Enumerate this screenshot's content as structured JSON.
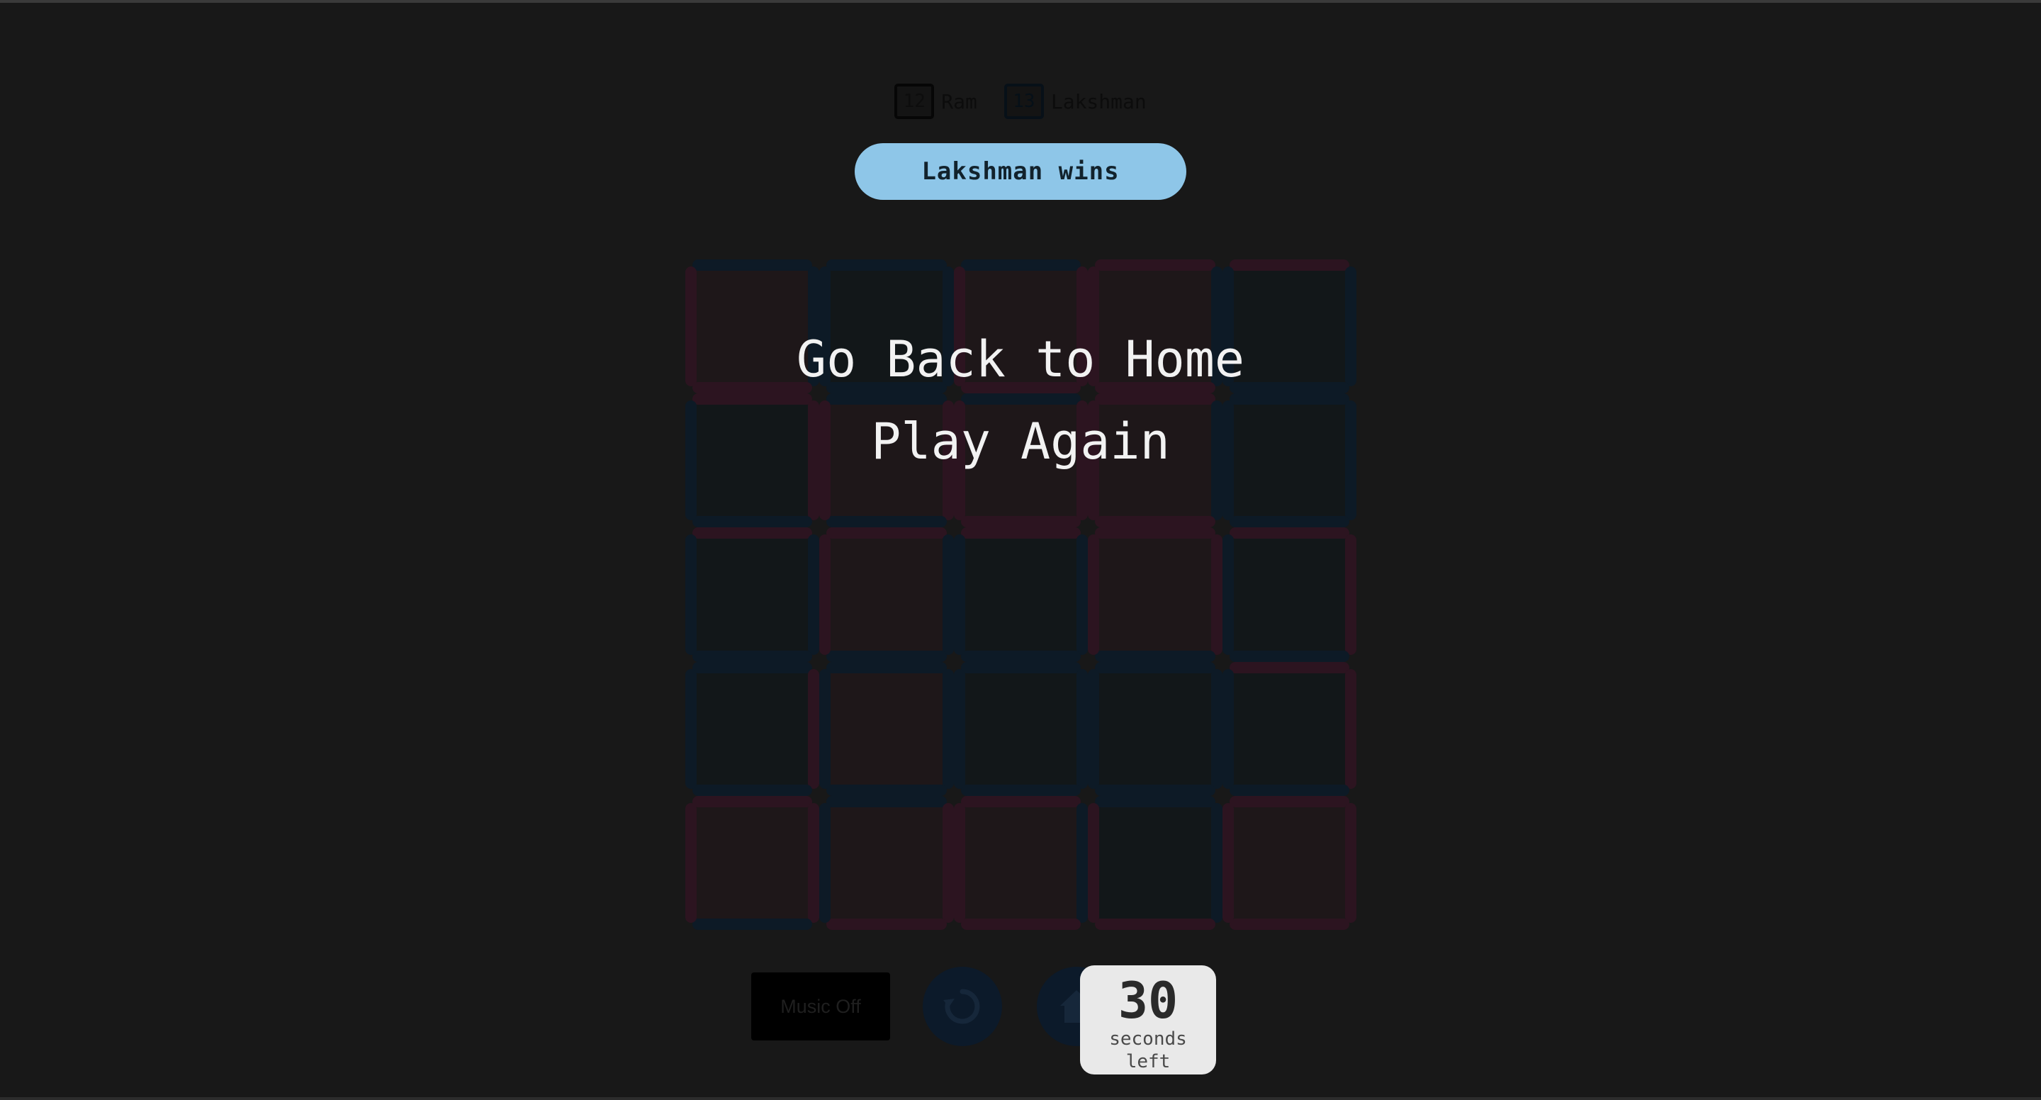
{
  "players": [
    {
      "name": "Ram",
      "score": "12"
    },
    {
      "name": "Lakshman",
      "score": "13"
    }
  ],
  "result": {
    "text": "Lakshman wins"
  },
  "menu": {
    "home_label": "Go Back to Home",
    "play_again_label": "Play Again"
  },
  "controls": {
    "music_label": "Music Off",
    "restart_icon": "restart-icon",
    "home_icon": "home-icon"
  },
  "timer": {
    "value": "30",
    "label": "seconds left"
  },
  "colors": {
    "background": "#181818",
    "banner": "#8ec6e8",
    "player1_edge": "#2c1420",
    "player2_edge": "#0d1a26",
    "player1_fill": "#1e1719",
    "player2_fill": "#121719",
    "timer_bg": "#e9e9e9"
  },
  "board": {
    "rows": 5,
    "cols": 5,
    "cell_owners": [
      [
        "p1",
        "p2",
        "p1",
        "p1",
        "p2"
      ],
      [
        "p2",
        "p1",
        "p1",
        "p1",
        "p2"
      ],
      [
        "p2",
        "p1",
        "p2",
        "p1",
        "p2"
      ],
      [
        "p2",
        "p1",
        "p2",
        "p2",
        "p2"
      ],
      [
        "p1",
        "p1",
        "p1",
        "p2",
        "p1"
      ]
    ],
    "edge_owners": [
      [
        [
          "p2",
          "p2",
          "p1",
          "p1"
        ],
        [
          "p2",
          "p2",
          "p2",
          "p2"
        ],
        [
          "p2",
          "p1",
          "p1",
          "p1"
        ],
        [
          "p1",
          "p2",
          "p1",
          "p1"
        ],
        [
          "p1",
          "p2",
          "p2",
          "p2"
        ]
      ],
      [
        [
          "p1",
          "p1",
          "p2",
          "p2"
        ],
        [
          "p2",
          "p1",
          "p2",
          "p1"
        ],
        [
          "p2",
          "p1",
          "p1",
          "p1"
        ],
        [
          "p1",
          "p2",
          "p1",
          "p1"
        ],
        [
          "p2",
          "p2",
          "p2",
          "p2"
        ]
      ],
      [
        [
          "p1",
          "p2",
          "p2",
          "p2"
        ],
        [
          "p1",
          "p2",
          "p2",
          "p1"
        ],
        [
          "p1",
          "p2",
          "p2",
          "p2"
        ],
        [
          "p1",
          "p1",
          "p2",
          "p1"
        ],
        [
          "p1",
          "p1",
          "p2",
          "p2"
        ]
      ],
      [
        [
          "p2",
          "p1",
          "p2",
          "p2"
        ],
        [
          "p2",
          "p2",
          "p2",
          "p2"
        ],
        [
          "p2",
          "p2",
          "p2",
          "p2"
        ],
        [
          "p2",
          "p2",
          "p2",
          "p2"
        ],
        [
          "p1",
          "p1",
          "p2",
          "p2"
        ]
      ],
      [
        [
          "p1",
          "p1",
          "p2",
          "p1"
        ],
        [
          "p2",
          "p1",
          "p1",
          "p2"
        ],
        [
          "p1",
          "p2",
          "p1",
          "p1"
        ],
        [
          "p2",
          "p2",
          "p1",
          "p1"
        ],
        [
          "p1",
          "p1",
          "p1",
          "p1"
        ]
      ]
    ]
  }
}
